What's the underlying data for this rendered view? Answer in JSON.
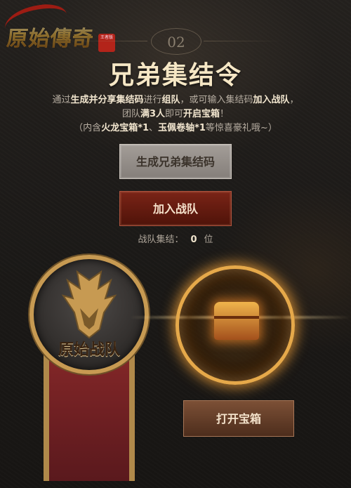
{
  "logo": {
    "text": "原始傳奇",
    "seal": "王者版"
  },
  "section": {
    "number": "02",
    "title": "兄弟集结令"
  },
  "description": {
    "line1_parts": [
      "通过",
      "生成并分享集结码",
      "进行",
      "组队",
      "，或可输入集结码",
      "加入战队",
      "，"
    ],
    "line2_parts": [
      "团队",
      "满3人",
      "即可",
      "开启宝箱",
      "！"
    ],
    "line3_parts": [
      "（内含",
      "火龙宝箱*1",
      "、",
      "玉佩卷轴*1",
      "等惊喜豪礼哦~）"
    ]
  },
  "buttons": {
    "generate": "生成兄弟集结码",
    "join": "加入战队",
    "open": "打开宝箱"
  },
  "team_count": {
    "label": "战队集结：",
    "value": "0",
    "unit": "位"
  },
  "emblem": {
    "label": "原始战队"
  }
}
